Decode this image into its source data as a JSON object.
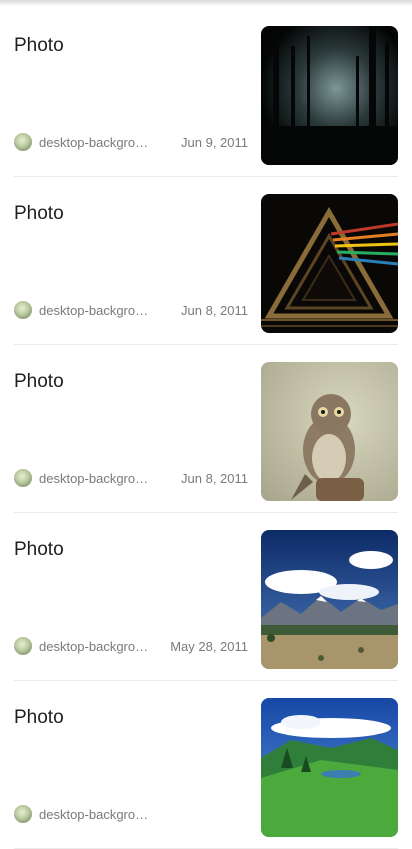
{
  "feed": {
    "items": [
      {
        "title": "Photo",
        "source": "desktop-backgrounds",
        "date": "Jun 9, 2011",
        "image": "dark-forest-photo"
      },
      {
        "title": "Photo",
        "source": "desktop-backgrounds",
        "date": "Jun 8, 2011",
        "image": "triangle-prism-photo"
      },
      {
        "title": "Photo",
        "source": "desktop-backgrounds",
        "date": "Jun 8, 2011",
        "image": "owl-photo"
      },
      {
        "title": "Photo",
        "source": "desktop-backgrounds",
        "date": "May 28, 2011",
        "image": "mountain-field-photo"
      },
      {
        "title": "Photo",
        "source": "desktop-backgrounds",
        "date": "",
        "image": "green-valley-photo"
      }
    ]
  }
}
